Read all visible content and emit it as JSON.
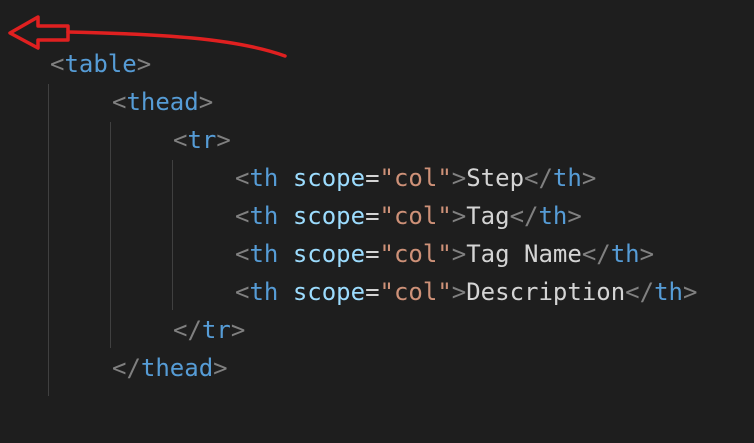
{
  "editor": {
    "language": "html",
    "colors": {
      "background": "#1e1e1e",
      "bracket": "#808080",
      "tag": "#569cd6",
      "attribute": "#9cdcfe",
      "string": "#ce9178",
      "text": "#d4d4d4",
      "indent_guide": "#404040",
      "annotation_arrow": "#e02020"
    },
    "lines": [
      {
        "tokens": [
          {
            "kind": "bracket",
            "text": "<"
          },
          {
            "kind": "tag",
            "text": "table"
          },
          {
            "kind": "bracket",
            "text": ">"
          }
        ]
      },
      {
        "tokens": [
          {
            "kind": "bracket",
            "text": "<"
          },
          {
            "kind": "tag",
            "text": "thead"
          },
          {
            "kind": "bracket",
            "text": ">"
          }
        ]
      },
      {
        "tokens": [
          {
            "kind": "bracket",
            "text": "<"
          },
          {
            "kind": "tag",
            "text": "tr"
          },
          {
            "kind": "bracket",
            "text": ">"
          }
        ]
      },
      {
        "tokens": [
          {
            "kind": "bracket",
            "text": "<"
          },
          {
            "kind": "tag",
            "text": "th"
          },
          {
            "kind": "text",
            "text": " "
          },
          {
            "kind": "attr",
            "text": "scope"
          },
          {
            "kind": "eq",
            "text": "="
          },
          {
            "kind": "string",
            "text": "\"col\""
          },
          {
            "kind": "bracket",
            "text": ">"
          },
          {
            "kind": "text",
            "text": "Step"
          },
          {
            "kind": "bracket",
            "text": "</"
          },
          {
            "kind": "tag",
            "text": "th"
          },
          {
            "kind": "bracket",
            "text": ">"
          }
        ]
      },
      {
        "tokens": [
          {
            "kind": "bracket",
            "text": "<"
          },
          {
            "kind": "tag",
            "text": "th"
          },
          {
            "kind": "text",
            "text": " "
          },
          {
            "kind": "attr",
            "text": "scope"
          },
          {
            "kind": "eq",
            "text": "="
          },
          {
            "kind": "string",
            "text": "\"col\""
          },
          {
            "kind": "bracket",
            "text": ">"
          },
          {
            "kind": "text",
            "text": "Tag"
          },
          {
            "kind": "bracket",
            "text": "</"
          },
          {
            "kind": "tag",
            "text": "th"
          },
          {
            "kind": "bracket",
            "text": ">"
          }
        ]
      },
      {
        "tokens": [
          {
            "kind": "bracket",
            "text": "<"
          },
          {
            "kind": "tag",
            "text": "th"
          },
          {
            "kind": "text",
            "text": " "
          },
          {
            "kind": "attr",
            "text": "scope"
          },
          {
            "kind": "eq",
            "text": "="
          },
          {
            "kind": "string",
            "text": "\"col\""
          },
          {
            "kind": "bracket",
            "text": ">"
          },
          {
            "kind": "text",
            "text": "Tag Name"
          },
          {
            "kind": "bracket",
            "text": "</"
          },
          {
            "kind": "tag",
            "text": "th"
          },
          {
            "kind": "bracket",
            "text": ">"
          }
        ]
      },
      {
        "tokens": [
          {
            "kind": "bracket",
            "text": "<"
          },
          {
            "kind": "tag",
            "text": "th"
          },
          {
            "kind": "text",
            "text": " "
          },
          {
            "kind": "attr",
            "text": "scope"
          },
          {
            "kind": "eq",
            "text": "="
          },
          {
            "kind": "string",
            "text": "\"col\""
          },
          {
            "kind": "bracket",
            "text": ">"
          },
          {
            "kind": "text",
            "text": "Description"
          },
          {
            "kind": "bracket",
            "text": "</"
          },
          {
            "kind": "tag",
            "text": "th"
          },
          {
            "kind": "bracket",
            "text": ">"
          }
        ]
      },
      {
        "tokens": [
          {
            "kind": "bracket",
            "text": "</"
          },
          {
            "kind": "tag",
            "text": "tr"
          },
          {
            "kind": "bracket",
            "text": ">"
          }
        ]
      },
      {
        "tokens": [
          {
            "kind": "bracket",
            "text": "</"
          },
          {
            "kind": "tag",
            "text": "thead"
          },
          {
            "kind": "bracket",
            "text": ">"
          }
        ]
      }
    ]
  },
  "annotation": {
    "shape": "red-arrow-pointing-left"
  }
}
